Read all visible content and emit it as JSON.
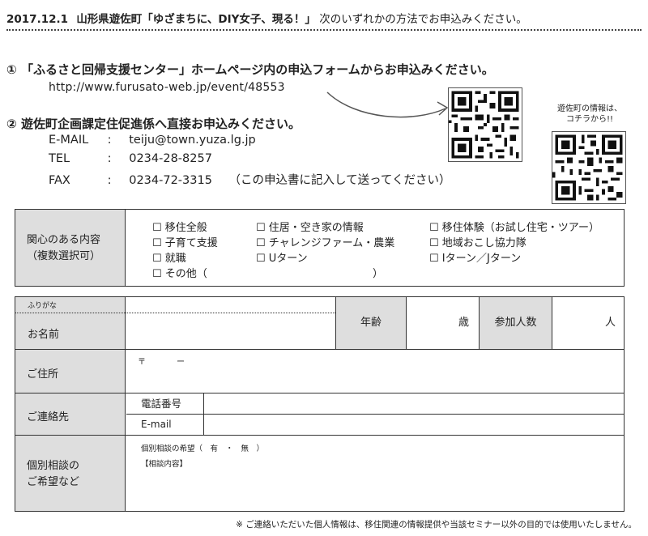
{
  "header": {
    "date": "2017.12.1",
    "event": "山形県遊佐町「ゆざまちに、DIY女子、現る！」",
    "instruction": "次のいずれかの方法でお申込みください。"
  },
  "option1": {
    "number": "①",
    "text": "「ふるさと回帰支援センター」ホームページ内の申込フォームからお申込みください。",
    "url": "http://www.furusato-web.jp/event/48553"
  },
  "option2": {
    "number": "②",
    "text": "遊佐町企画課定住促進係へ直接お申込みください。",
    "rows": [
      {
        "label": "E-MAIL",
        "sep": ":",
        "value": "teiju@town.yuza.lg.jp",
        "note": ""
      },
      {
        "label": "TEL",
        "sep": ":",
        "value": "0234-28-8257",
        "note": ""
      },
      {
        "label": "FAX",
        "sep": ":",
        "value": "0234-72-3315",
        "note": "（この申込書に記入して送ってください）"
      }
    ]
  },
  "qr_caption": {
    "line1": "遊佐町の情報は、",
    "line2": "コチラから!!"
  },
  "interests": {
    "label_line1": "関心のある内容",
    "label_line2": "（複数選択可）",
    "options": [
      "移住全般",
      "住居・空き家の情報",
      "移住体験（お試し住宅・ツアー）",
      "子育て支援",
      "チャレンジファーム・農業",
      "地域おこし協力隊",
      "就職",
      "Uターン",
      "Iターン／Jターン",
      "その他（",
      "）"
    ]
  },
  "form": {
    "furigana": "ふりがな",
    "name": "お名前",
    "age": "年齢",
    "age_unit": "歳",
    "participants": "参加人数",
    "participants_unit": "人",
    "address": "ご住所",
    "postal_mark": "〒",
    "postal_dash": "ー",
    "contact": "ご連絡先",
    "phone": "電話番号",
    "email": "E-mail",
    "consult_line1": "個別相談の",
    "consult_line2": "ご希望など",
    "consult_wish": "個別相談の希望（　有　・　無　）",
    "consult_content": "【相談内容】"
  },
  "footer_note": "※ ご連絡いただいた個人情報は、移住関連の情報提供や当該セミナー以外の目的では使用いたしません。"
}
